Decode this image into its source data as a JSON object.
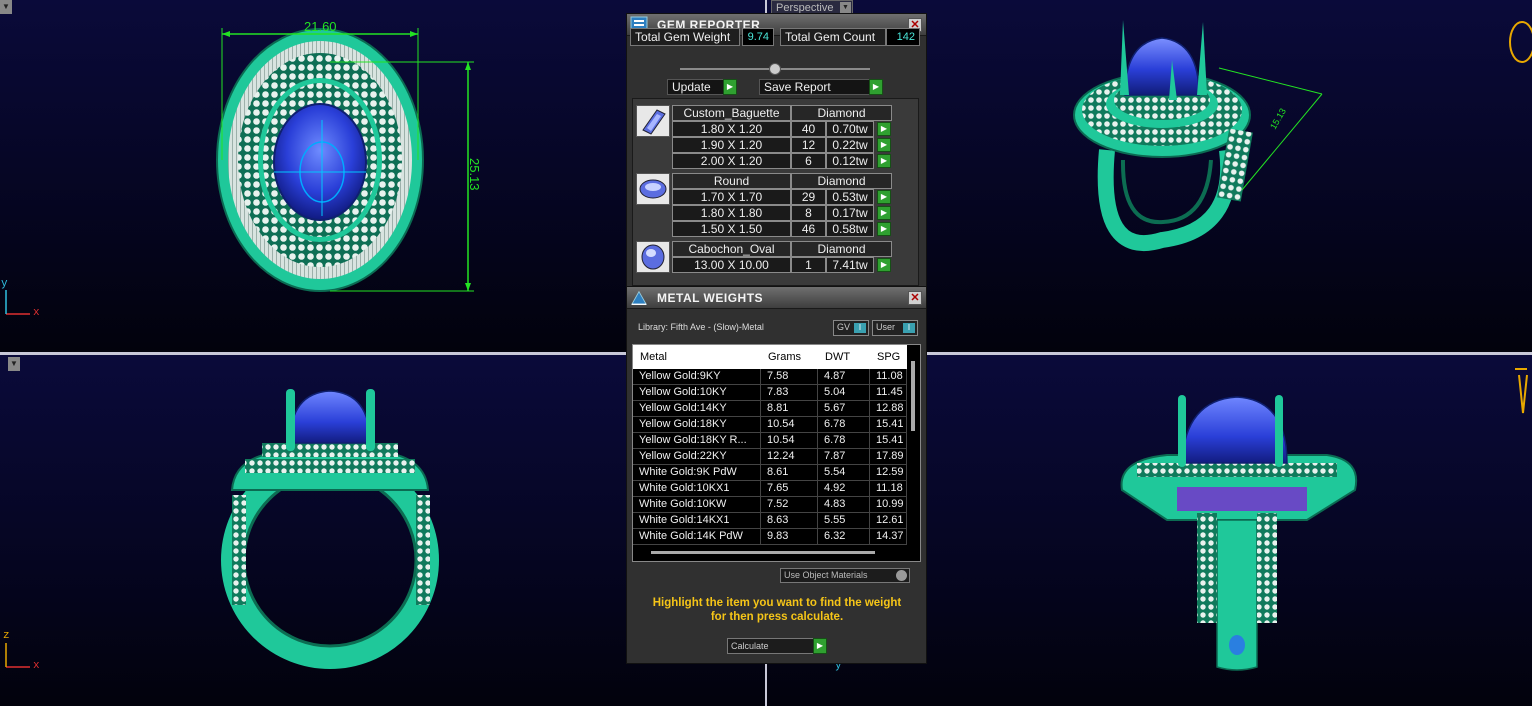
{
  "viewports": {
    "top_left": {
      "dimension_width": "21.60",
      "dimension_height": "25.13",
      "axis_v": "y",
      "axis_h": "x"
    },
    "top_right": {
      "menu_label": "Perspective",
      "dimension_label": "15.13"
    },
    "bottom_left": {
      "axis_v": "z",
      "axis_h": "x"
    },
    "bottom_right": {
      "axis_v": "y"
    }
  },
  "gem_reporter": {
    "title": "GEM REPORTER",
    "total_weight_label": "Total Gem Weight",
    "total_weight_value": "9.74",
    "total_count_label": "Total Gem Count",
    "total_count_value": "142",
    "update_label": "Update",
    "save_label": "Save Report",
    "groups": [
      {
        "shape": "Custom_Baguette",
        "material": "Diamond",
        "icon": "baguette-gem-icon",
        "rows": [
          {
            "size": "1.80 X 1.20",
            "count": "40",
            "weight": "0.70tw"
          },
          {
            "size": "1.90 X 1.20",
            "count": "12",
            "weight": "0.22tw"
          },
          {
            "size": "2.00 X 1.20",
            "count": "6",
            "weight": "0.12tw"
          }
        ]
      },
      {
        "shape": "Round",
        "material": "Diamond",
        "icon": "round-gem-icon",
        "rows": [
          {
            "size": "1.70 X 1.70",
            "count": "29",
            "weight": "0.53tw"
          },
          {
            "size": "1.80 X 1.80",
            "count": "8",
            "weight": "0.17tw"
          },
          {
            "size": "1.50 X 1.50",
            "count": "46",
            "weight": "0.58tw"
          }
        ]
      },
      {
        "shape": "Cabochon_Oval",
        "material": "Diamond",
        "icon": "cabochon-gem-icon",
        "rows": [
          {
            "size": "13.00 X 10.00",
            "count": "1",
            "weight": "7.41tw"
          }
        ]
      }
    ]
  },
  "metal_weights": {
    "title": "METAL WEIGHTS",
    "library": "Library: Fifth Ave - (Slow)-Metal",
    "gv_label": "GV",
    "user_label": "User",
    "columns": [
      "Metal",
      "Grams",
      "DWT",
      "SPG"
    ],
    "rows": [
      [
        "Yellow Gold:9KY",
        "7.58",
        "4.87",
        "11.08"
      ],
      [
        "Yellow Gold:10KY",
        "7.83",
        "5.04",
        "11.45"
      ],
      [
        "Yellow Gold:14KY",
        "8.81",
        "5.67",
        "12.88"
      ],
      [
        "Yellow Gold:18KY",
        "10.54",
        "6.78",
        "15.41"
      ],
      [
        "Yellow Gold:18KY R...",
        "10.54",
        "6.78",
        "15.41"
      ],
      [
        "Yellow Gold:22KY",
        "12.24",
        "7.87",
        "17.89"
      ],
      [
        "White Gold:9K PdW",
        "8.61",
        "5.54",
        "12.59"
      ],
      [
        "White Gold:10KX1",
        "7.65",
        "4.92",
        "11.18"
      ],
      [
        "White Gold:10KW",
        "7.52",
        "4.83",
        "10.99"
      ],
      [
        "White Gold:14KX1",
        "8.63",
        "5.55",
        "12.61"
      ],
      [
        "White Gold:14K PdW",
        "9.83",
        "6.32",
        "14.37"
      ]
    ],
    "materials_dropdown": "Use Object Materials",
    "note_line1": "Highlight the item you want to find the weight",
    "note_line2": "for then press calculate.",
    "calculate_label": "Calculate"
  },
  "colors": {
    "ring_metal": "#1fc89a",
    "gemstone": "#2a3fd8",
    "dimension_lines": "#23e323",
    "note_text": "#f5c518",
    "value_text": "#49e6d8"
  }
}
